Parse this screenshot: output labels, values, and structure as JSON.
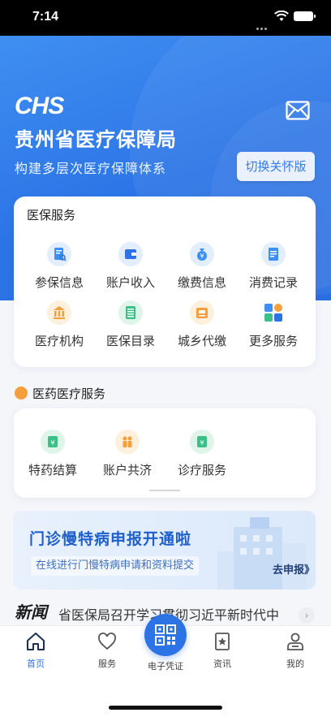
{
  "status_bar": {
    "time": "7:14"
  },
  "hero": {
    "logo_text": "CHS",
    "title": "贵州省医疗保障局",
    "subtitle": "构建多层次医疗保障体系",
    "care_button": "切换关怀版",
    "mail_icon": "mail-icon"
  },
  "insurance_services": {
    "title": "医保服务",
    "items": [
      {
        "label": "参保信息",
        "icon": "document-search-icon",
        "color": "#3f8ff2"
      },
      {
        "label": "账户收入",
        "icon": "wallet-icon",
        "color": "#2c74e6"
      },
      {
        "label": "缴费信息",
        "icon": "money-bag-icon",
        "color": "#3f8ff2"
      },
      {
        "label": "消费记录",
        "icon": "receipt-icon",
        "color": "#3f8ff2"
      },
      {
        "label": "医疗机构",
        "icon": "institution-icon",
        "color": "#f3a03c"
      },
      {
        "label": "医保目录",
        "icon": "catalog-icon",
        "color": "#3cc08a"
      },
      {
        "label": "城乡代缴",
        "icon": "cashier-icon",
        "color": "#f3a03c"
      },
      {
        "label": "更多服务",
        "icon": "more-apps-icon",
        "color": "#2c74e6"
      }
    ]
  },
  "medical_services": {
    "title": "医药医疗服务",
    "items": [
      {
        "label": "特药结算",
        "icon": "pharmacy-settlement-icon",
        "color": "#3cc08a"
      },
      {
        "label": "账户共济",
        "icon": "family-share-icon",
        "color": "#f3a03c"
      },
      {
        "label": "诊疗服务",
        "icon": "medical-service-icon",
        "color": "#3cc08a"
      }
    ]
  },
  "banner": {
    "title": "门诊慢特病申报开通啦",
    "subtitle": "在线进行门慢特病申请和资料提交",
    "button": "去申报》"
  },
  "news": {
    "logo": "新闻",
    "headline": "省医保局召开学习贯彻习近平新时代中",
    "more": "›"
  },
  "tabbar": {
    "tabs": [
      {
        "label": "首页",
        "icon": "home-icon",
        "active": true
      },
      {
        "label": "服务",
        "icon": "heart-icon",
        "active": false
      },
      {
        "label": "电子凭证",
        "icon": "qr-code-icon",
        "active": false
      },
      {
        "label": "资讯",
        "icon": "news-bookmark-icon",
        "active": false
      },
      {
        "label": "我的",
        "icon": "user-icon",
        "active": false
      }
    ]
  },
  "colors": {
    "primary": "#2c74e6",
    "accent_orange": "#f3a03c",
    "accent_green": "#3cc08a"
  }
}
